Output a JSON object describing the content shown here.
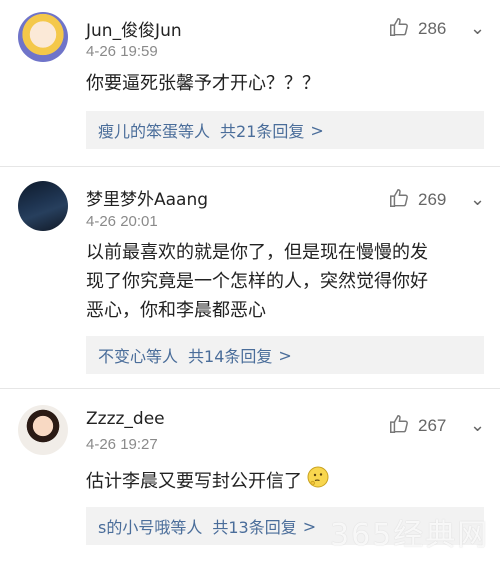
{
  "colors": {
    "link": "#4a6d9a",
    "reply_bg": "#f2f2f2",
    "muted": "#8a8a8a"
  },
  "comments": [
    {
      "username": "Jun_俊俊Jun",
      "time": "4-26 19:59",
      "likes": "286",
      "like_icon": "thumbs-up-icon",
      "more_icon": "chevron-down-icon",
      "content": "你要逼死张馨予才开心？？？",
      "reply_users": "瘦儿的笨蛋等人",
      "reply_total": "共21条回复",
      "reply_arrow": ">"
    },
    {
      "username": "梦里梦外Aaang",
      "time": "4-26 20:01",
      "likes": "269",
      "like_icon": "thumbs-up-icon",
      "more_icon": "chevron-down-icon",
      "content_lines": [
        "以前最喜欢的就是你了，但是现在慢慢的发",
        "现了你究竟是一个怎样的人，突然觉得你好",
        "恶心，你和李晨都恶心"
      ],
      "reply_users": "不变心等人",
      "reply_total": "共14条回复",
      "reply_arrow": ">"
    },
    {
      "username": "Zzzz_dee",
      "time": "4-26 19:27",
      "likes": "267",
      "like_icon": "thumbs-up-icon",
      "more_icon": "chevron-down-icon",
      "content": "估计李晨又要写封公开信了",
      "emoji": "thinking-face-icon",
      "reply_users": "s的小号哦等人",
      "reply_total": "共13条回复",
      "reply_arrow": ">"
    }
  ],
  "watermark": "365经典网"
}
